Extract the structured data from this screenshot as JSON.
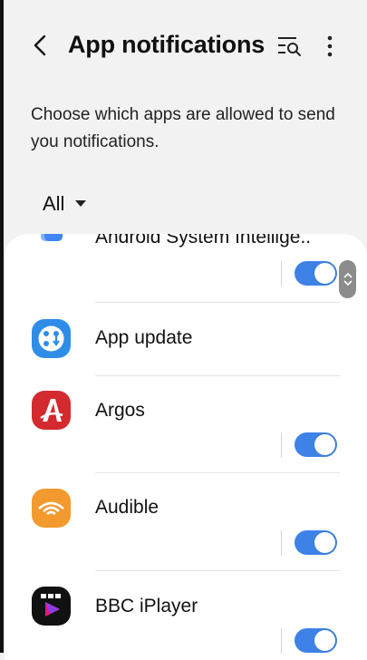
{
  "header": {
    "title": "App notifications",
    "back_icon": "back-chevron-icon",
    "search_icon": "search-list-icon",
    "more_icon": "more-vertical-icon"
  },
  "description": "Choose which apps are allowed to send you notifications.",
  "filter": {
    "selected": "All"
  },
  "apps": [
    {
      "name": "Android System Intellige..",
      "toggle": "on"
    },
    {
      "name": "App update",
      "toggle": null
    },
    {
      "name": "Argos",
      "toggle": "on"
    },
    {
      "name": "Audible",
      "toggle": "on"
    },
    {
      "name": "BBC iPlayer",
      "toggle": "on"
    }
  ],
  "colors": {
    "accent": "#3e82e7",
    "background": "#f2f2f2",
    "card": "#ffffff"
  }
}
